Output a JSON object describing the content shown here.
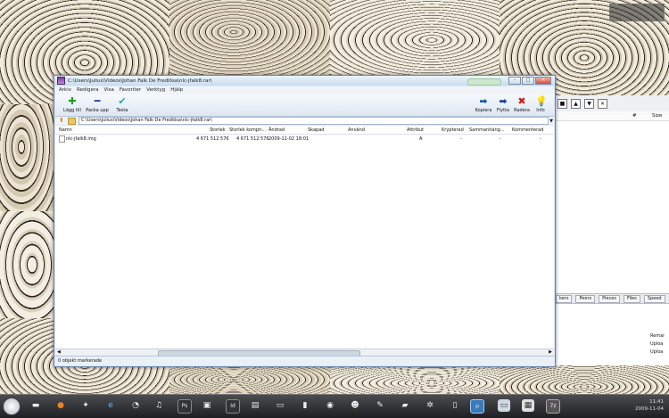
{
  "winrar": {
    "title": "C:\\Users\\Julius\\Videos\\Johan Falk De Fredlösa\\nlc-jfalk8.rar\\",
    "menu": [
      "Arkiv",
      "Redigera",
      "Visa",
      "Favoriter",
      "Verktyg",
      "Hjälp"
    ],
    "toolbar": {
      "add": "Lägg till",
      "extract": "Packa upp",
      "test": "Testa",
      "copy": "Kopiera",
      "move": "Flytta",
      "delete": "Radera",
      "info": "Info"
    },
    "address": "C:\\Users\\Julius\\Videos\\Johan Falk De Fredlösa\\nlc-jfalk8.rar\\",
    "columns": [
      "Namn",
      "Storlek",
      "Storlek kompri...",
      "Ändrad",
      "Skapad",
      "Använd",
      "Attribut",
      "Krypterad",
      "Sammanhäng...",
      "Kommenterad"
    ],
    "rows": [
      {
        "name": "nlc-jfalk8.img",
        "size": "4 671 512 576",
        "packed": "4 671 512 576",
        "modified": "2009-11-02 18:01",
        "created": "",
        "accessed": "",
        "attributes": "A",
        "encrypted": "-",
        "solid": "-",
        "comment": "-"
      }
    ],
    "status": "0 objekt markerade"
  },
  "rightapp": {
    "col_hash": "#",
    "col_size": "Size",
    "tabs": [
      "kers",
      "Peers",
      "Pieces",
      "Files",
      "Speed"
    ],
    "info": [
      "Remai",
      "Uploa",
      "Uploa"
    ]
  },
  "tray": {
    "time": "11:41",
    "date": "2009-11-04"
  },
  "colors": {
    "title_bg": "#c9dcf0",
    "taskbar_bg": "#1e1f22",
    "add_icon": "#1aa31a",
    "extract_icon": "#1f3fa8",
    "test_icon": "#2aa6a6",
    "delete_icon": "#d01818"
  }
}
